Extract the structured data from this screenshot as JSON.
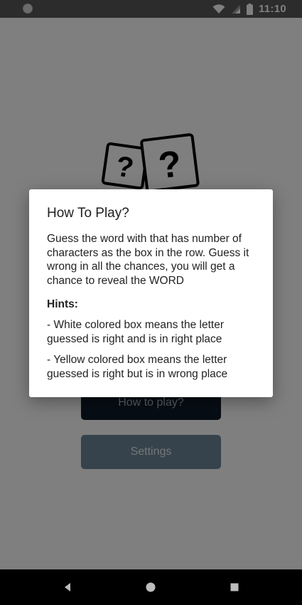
{
  "status_bar": {
    "time": "11:10",
    "icons": [
      "circle-icon",
      "wifi-icon",
      "cell-signal-icon",
      "battery-icon"
    ]
  },
  "app": {
    "logo": "question-dice-logo",
    "buttons": {
      "how_to_play_label": "How to play?",
      "settings_label": "Settings"
    },
    "colors": {
      "how_to_play_button": "#0e1b2a",
      "settings_button": "#6d8699"
    }
  },
  "dialog": {
    "title": "How To Play?",
    "body": "Guess the word with that has number of characters as the box in the row. Guess it wrong in all the chances, you will get a chance to reveal the WORD",
    "hints_title": "Hints:",
    "hints": [
      "- White colored box means the letter guessed is right and is in right place",
      "- Yellow colored box means the letter guessed is right but is in wrong place"
    ]
  },
  "nav_bar": {
    "icons": [
      "back-icon",
      "home-icon",
      "recents-icon"
    ]
  }
}
